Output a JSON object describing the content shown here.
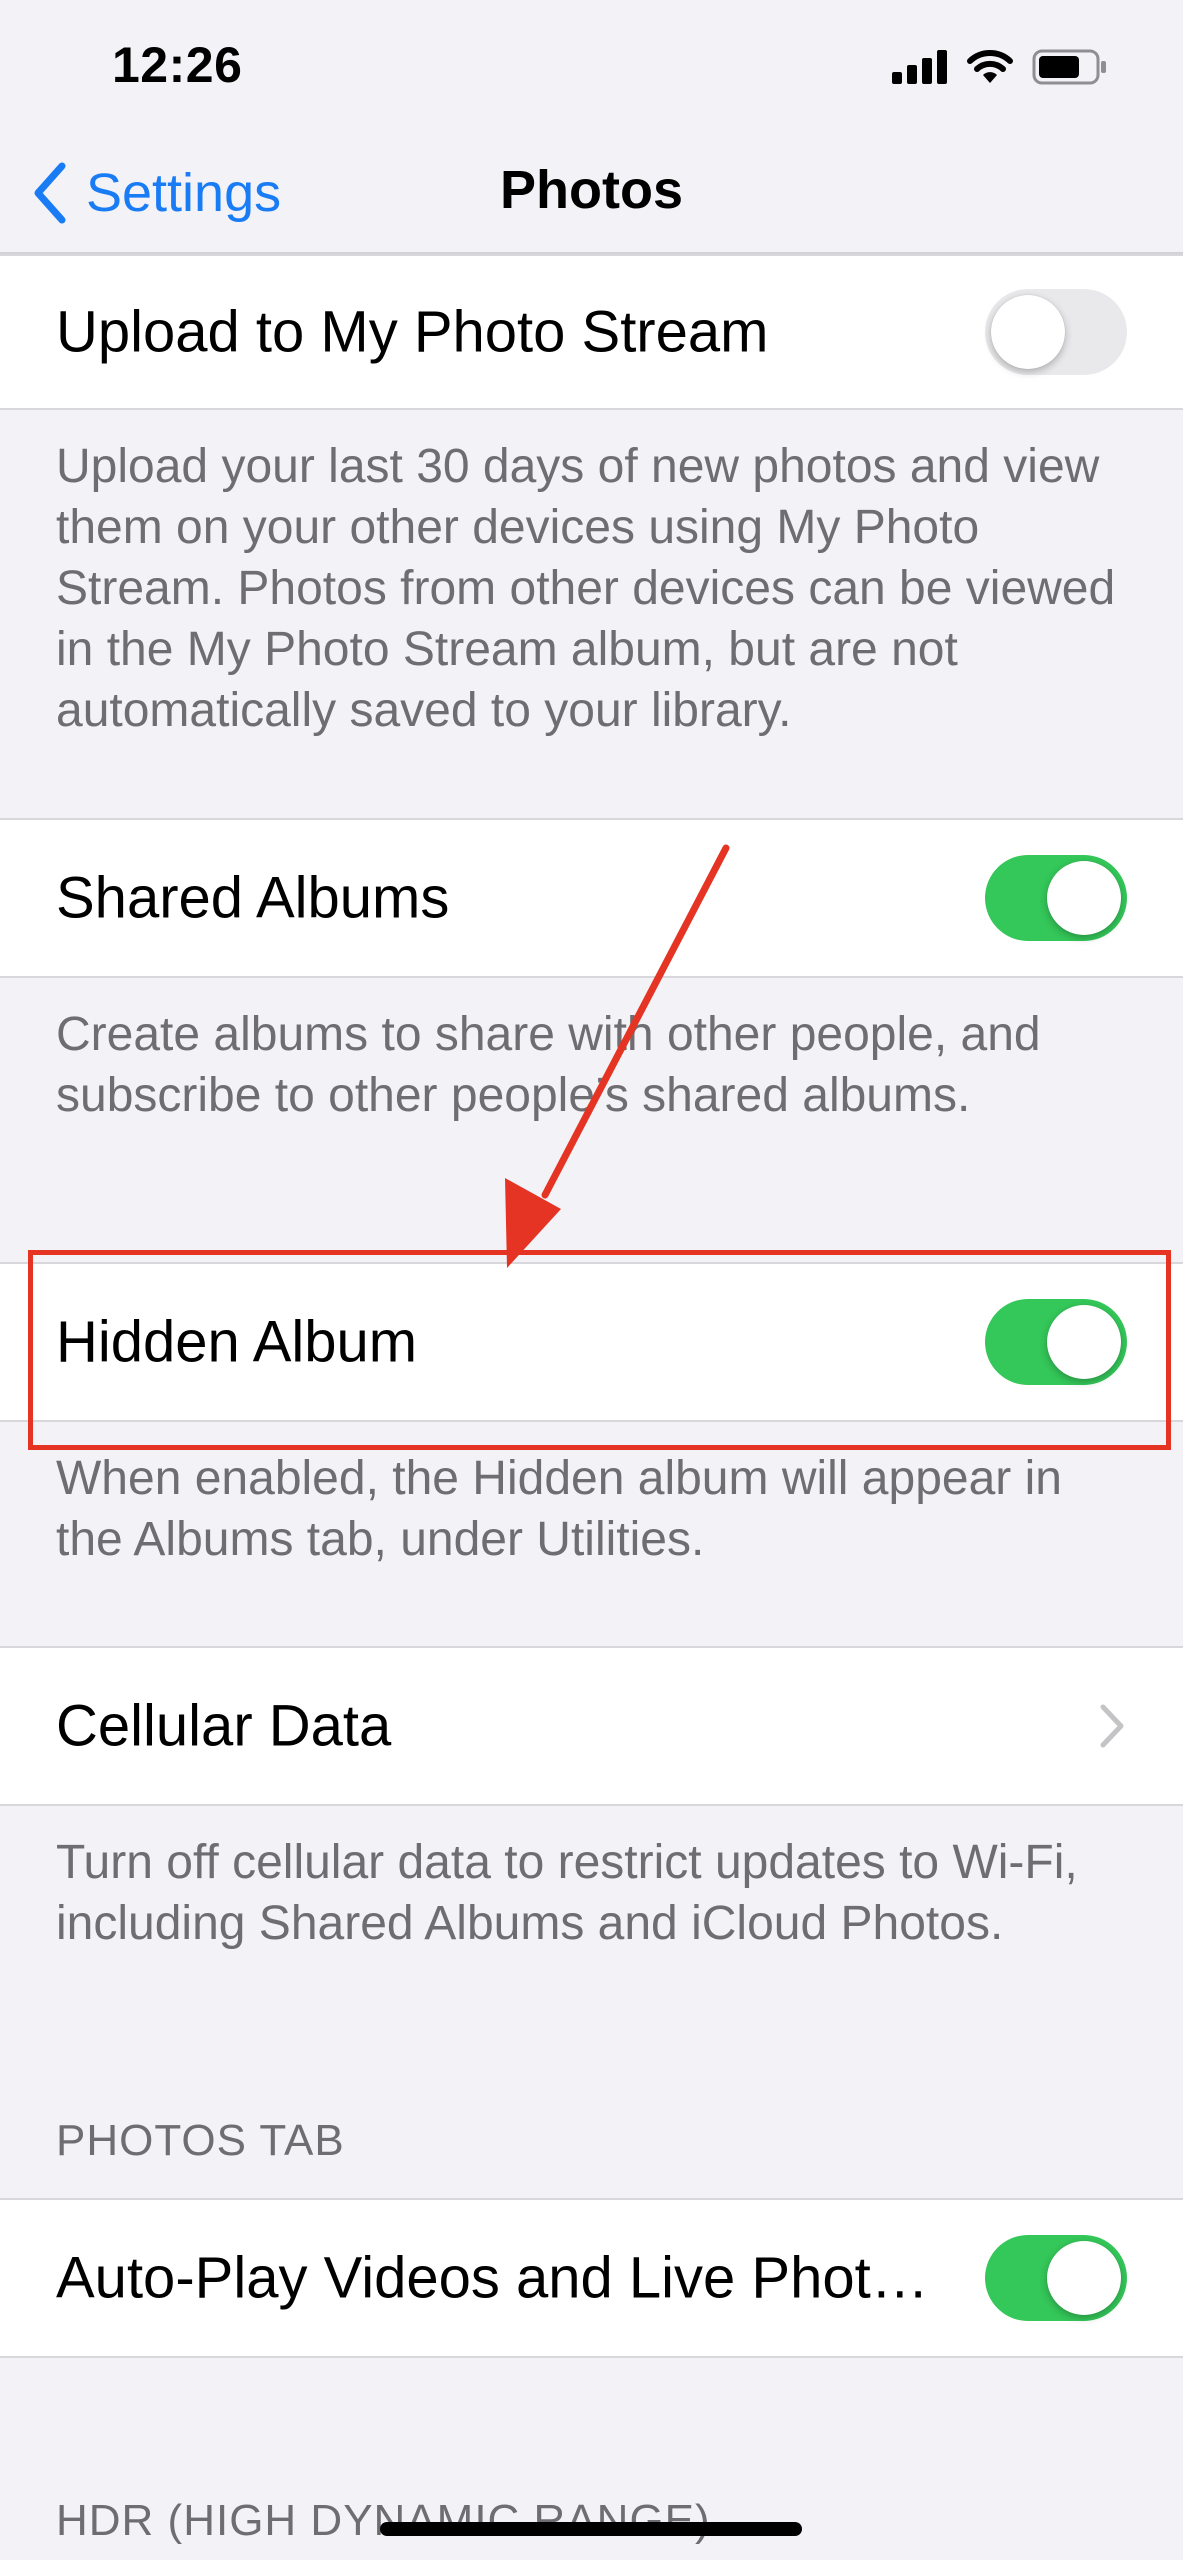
{
  "status_bar": {
    "time": "12:26"
  },
  "nav": {
    "back_label": "Settings",
    "title": "Photos"
  },
  "rows": {
    "photo_stream": {
      "label": "Upload to My Photo Stream",
      "toggle": "off",
      "footer": "Upload your last 30 days of new photos and view them on your other devices using My Photo Stream. Photos from other devices can be viewed in the My Photo Stream album, but are not automatically saved to your library."
    },
    "shared_albums": {
      "label": "Shared Albums",
      "toggle": "on",
      "footer": "Create albums to share with other people, and subscribe to other people’s shared albums."
    },
    "hidden_album": {
      "label": "Hidden Album",
      "toggle": "on",
      "footer": "When enabled, the Hidden album will appear in the Albums tab, under Utilities."
    },
    "cellular_data": {
      "label": "Cellular Data",
      "footer": "Turn off cellular data to restrict updates to Wi-Fi, including Shared Albums and iCloud Photos."
    },
    "auto_play": {
      "label": "Auto-Play Videos and Live Phot…",
      "toggle": "on"
    }
  },
  "sections": {
    "photos_tab": "PHOTOS TAB",
    "hdr": "HDR (HIGH DYNAMIC RANGE)"
  },
  "colors": {
    "accent": "#1a7cf5",
    "toggle_on": "#34c759",
    "annotation": "#e53423"
  }
}
